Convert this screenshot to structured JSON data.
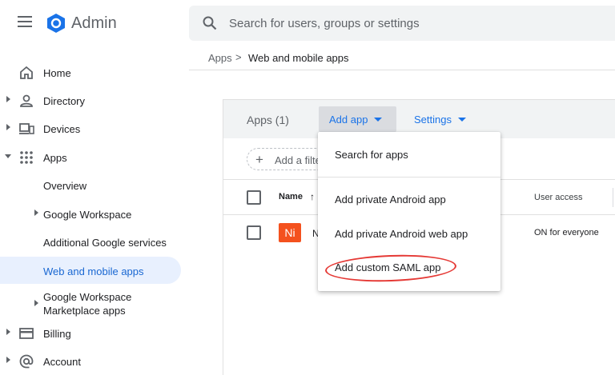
{
  "header": {
    "brand": "Admin",
    "search_placeholder": "Search for users, groups or settings"
  },
  "breadcrumb": {
    "root": "Apps",
    "separator": ">",
    "current": "Web and mobile apps"
  },
  "sidebar": {
    "items": [
      {
        "label": "Home",
        "icon": "home-icon"
      },
      {
        "label": "Directory",
        "icon": "person-icon"
      },
      {
        "label": "Devices",
        "icon": "devices-icon"
      },
      {
        "label": "Apps",
        "icon": "apps-grid-icon"
      },
      {
        "label": "Overview"
      },
      {
        "label": "Google Workspace"
      },
      {
        "label": "Additional Google services"
      },
      {
        "label": "Web and mobile apps"
      },
      {
        "label": "Google Workspace Marketplace apps"
      },
      {
        "label": "Billing",
        "icon": "billing-icon"
      },
      {
        "label": "Account",
        "icon": "account-at-icon"
      }
    ]
  },
  "main": {
    "apps_count": "Apps (1)",
    "add_app_label": "Add app",
    "settings_label": "Settings",
    "filter_label": "Add a filte",
    "columns": {
      "name": "Name",
      "user_access": "User access"
    },
    "rows": [
      {
        "tile": "Ni",
        "name": "N",
        "user_access": "ON for everyone"
      }
    ]
  },
  "menu": {
    "items": [
      {
        "label": "Search for apps"
      },
      {
        "label": "Add private Android app"
      },
      {
        "label": "Add private Android web app"
      },
      {
        "label": "Add custom SAML app"
      }
    ]
  },
  "colors": {
    "accent": "#1a73e8",
    "active_bg": "#e8f0fe",
    "highlight": "#e53935",
    "app_tile": "#f4511e"
  }
}
